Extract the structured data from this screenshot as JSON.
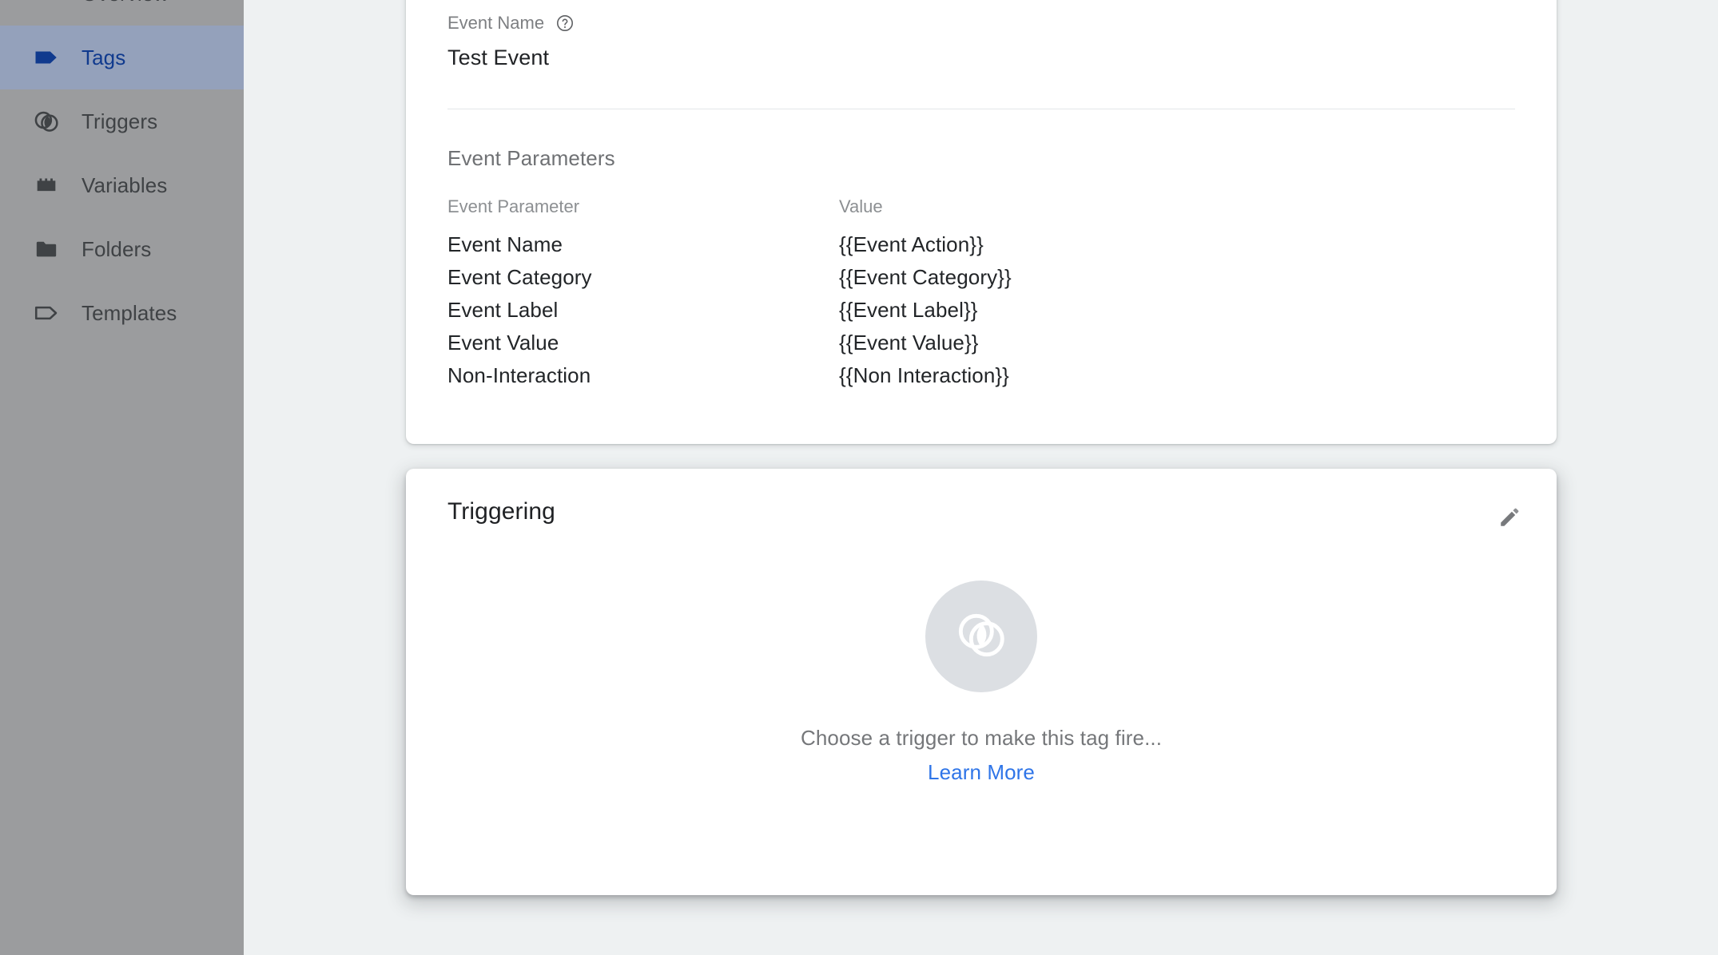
{
  "sidebar": {
    "items": [
      {
        "label": "Overview",
        "icon": "overview-icon",
        "active": false
      },
      {
        "label": "Tags",
        "icon": "tag-filled-icon",
        "active": true
      },
      {
        "label": "Triggers",
        "icon": "triggers-icon",
        "active": false
      },
      {
        "label": "Variables",
        "icon": "variables-icon",
        "active": false
      },
      {
        "label": "Folders",
        "icon": "folder-icon",
        "active": false
      },
      {
        "label": "Templates",
        "icon": "tag-outline-icon",
        "active": false
      }
    ]
  },
  "event_card": {
    "field_label": "Event Name",
    "help_icon": "help-circle-icon",
    "field_value": "Test Event",
    "section_title": "Event Parameters",
    "table": {
      "headers": [
        "Event Parameter",
        "Value"
      ],
      "rows": [
        {
          "parameter": "Event Name",
          "value": "{{Event Action}}"
        },
        {
          "parameter": "Event Category",
          "value": "{{Event Category}}"
        },
        {
          "parameter": "Event Label",
          "value": "{{Event Label}}"
        },
        {
          "parameter": "Event Value",
          "value": "{{Event Value}}"
        },
        {
          "parameter": "Non-Interaction",
          "value": "{{Non Interaction}}"
        }
      ]
    }
  },
  "triggering_card": {
    "title": "Triggering",
    "edit_icon": "pencil-icon",
    "empty_icon": "triggers-icon",
    "empty_text": "Choose a trigger to make this tag fire...",
    "learn_more_label": "Learn More"
  },
  "colors": {
    "background": "#eef1f2",
    "card": "#ffffff",
    "sidebar": "#9b9c9e",
    "sidebar_active_bg": "#94a1bb",
    "sidebar_active_text": "#103a8e",
    "link": "#2f75e8",
    "muted_text": "#7d7f82",
    "empty_circle": "#dcdfe3"
  }
}
